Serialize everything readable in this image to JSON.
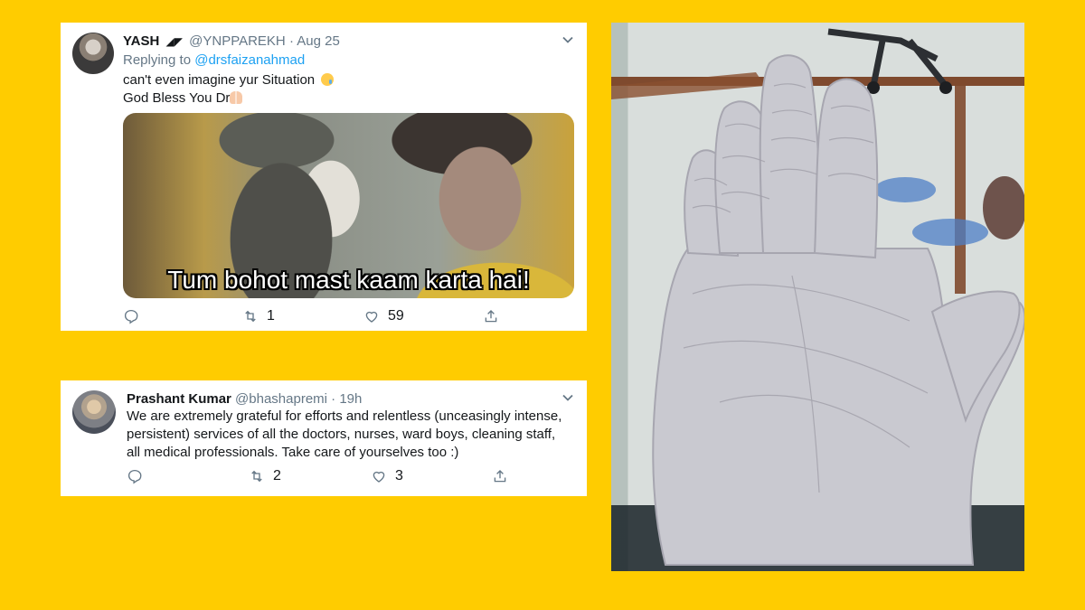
{
  "tweet1": {
    "name": "YASH",
    "name_glyphs": "◢◤",
    "handle": "@YNPPAREKH",
    "separator": "·",
    "date": "Aug 25",
    "replying_label": "Replying to",
    "replying_to": "@drsfaizanahmad",
    "line1": "can't even imagine yur Situation",
    "line2": "God Bless You Dr",
    "emoji1": "sad-tear-face-emoji",
    "emoji2": "folded-hands-emoji",
    "meme_caption": "Tum bohot mast kaam karta hai!",
    "retweets": "1",
    "likes": "59"
  },
  "tweet2": {
    "name": "Prashant Kumar",
    "handle": "@bhashapremi",
    "separator": "·",
    "date": "19h",
    "text": "We are extremely grateful for efforts and relentless (unceasingly intense, persistent) services of all the doctors, nurses, ward boys, cleaning staff, all medical professionals. Take care of yourselves too :)",
    "retweets": "2",
    "likes": "3"
  },
  "icons": {
    "reply": "reply-icon",
    "retweet": "retweet-icon",
    "like": "heart-icon",
    "share": "share-icon",
    "menu": "chevron-down-icon"
  },
  "colors": {
    "background": "#FFCC00",
    "link": "#1da1f2",
    "muted": "#657786"
  }
}
